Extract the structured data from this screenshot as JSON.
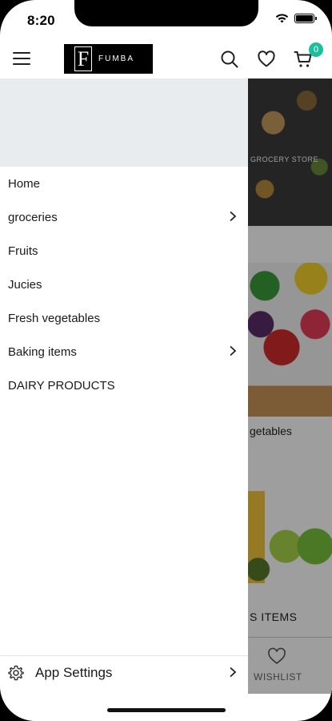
{
  "status_bar": {
    "time": "8:20",
    "icons": [
      "wifi-icon",
      "battery-icon"
    ]
  },
  "header": {
    "logo_mark": "F",
    "logo_text": "FUMBA",
    "icons": [
      "menu-icon",
      "search-icon",
      "heart-icon",
      "cart-icon"
    ],
    "cart_count": "0"
  },
  "drawer": {
    "items": [
      {
        "label": "Home",
        "has_submenu": false
      },
      {
        "label": "groceries",
        "has_submenu": true
      },
      {
        "label": "Fruits",
        "has_submenu": false
      },
      {
        "label": "Jucies",
        "has_submenu": false
      },
      {
        "label": "Fresh vegetables",
        "has_submenu": false
      },
      {
        "label": "Baking items",
        "has_submenu": true
      },
      {
        "label": "DAIRY PRODUCTS",
        "has_submenu": false
      }
    ],
    "footer": {
      "label": "App Settings",
      "icon": "gear-icon"
    }
  },
  "background_page": {
    "grocery_label": "GROCERY STORE",
    "veg_label_partial": "getables",
    "baking_label_partial": "S ITEMS",
    "tab_wishlist": "WISHLIST"
  },
  "colors": {
    "accent": "#1bbf9c",
    "drawer_banner": "#e9ecef",
    "logo_bg": "#000000"
  }
}
